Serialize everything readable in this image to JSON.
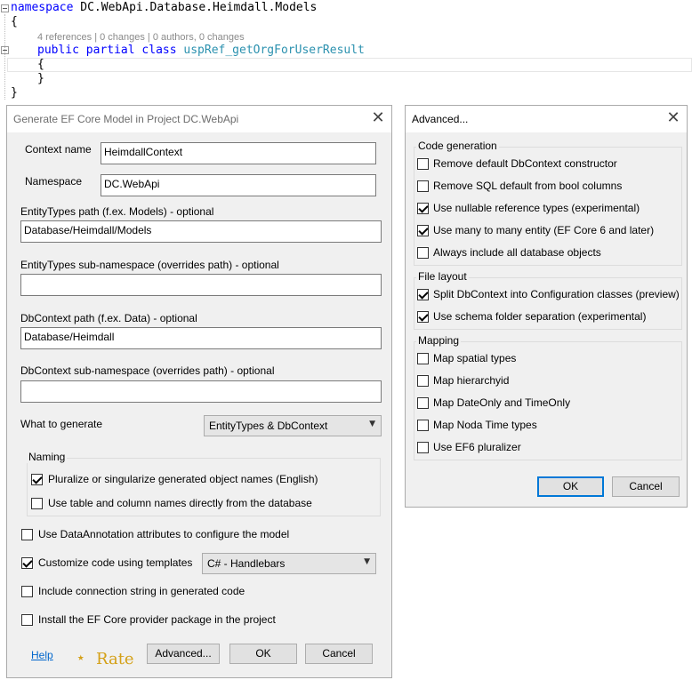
{
  "editor": {
    "line1_kw": "namespace",
    "line1_ns": " DC.WebApi.Database.Heimdall.Models",
    "open_brace": "{",
    "codelens": "4 references | 0 changes | 0 authors, 0 changes",
    "line3_kw1": "public",
    "line3_kw2": "partial",
    "line3_kw3": "class",
    "line3_class": "uspRef_getOrgForUserResult",
    "inner_open": "{",
    "inner_close": "}",
    "close_brace": "}"
  },
  "main_dialog": {
    "title": "Generate EF Core Model in Project DC.WebApi",
    "close": "✕",
    "context_name_label": "Context name",
    "context_name_value": "HeimdallContext",
    "namespace_label": "Namespace",
    "namespace_value": "DC.WebApi",
    "entity_path_label": "EntityTypes path (f.ex. Models) - optional",
    "entity_path_value": "Database/Heimdall/Models",
    "entity_subns_label": "EntityTypes sub-namespace (overrides path) - optional",
    "entity_subns_value": "",
    "dbcontext_path_label": "DbContext path (f.ex. Data) - optional",
    "dbcontext_path_value": "Database/Heimdall",
    "dbcontext_subns_label": "DbContext sub-namespace (overrides path) - optional",
    "dbcontext_subns_value": "",
    "what_to_generate_label": "What to generate",
    "what_to_generate_value": "EntityTypes & DbContext",
    "naming_caption": "Naming",
    "pluralize_label": "Pluralize or singularize generated object names (English)",
    "use_table_names_label": "Use table and column names directly from the database",
    "data_annotation_label": "Use DataAnnotation attributes to configure the model",
    "customize_templates_label": "Customize code using templates",
    "template_value": "C# - Handlebars",
    "include_conn_label": "Include connection string in generated code",
    "install_provider_label": "Install the EF Core provider package in the project",
    "help_link": "Help",
    "rate_star": "⭑",
    "rate_text": "Rate",
    "advanced_button": "Advanced...",
    "ok_button": "OK",
    "cancel_button": "Cancel"
  },
  "advanced_dialog": {
    "title": "Advanced...",
    "close": "✕",
    "code_generation_caption": "Code generation",
    "opt_remove_ctor": "Remove default DbContext constructor",
    "opt_remove_sql_default": "Remove SQL default from bool columns",
    "opt_nullable_refs": "Use nullable reference types (experimental)",
    "opt_many_to_many": "Use many to many entity (EF Core 6 and later)",
    "opt_include_all": "Always include all database objects",
    "file_layout_caption": "File layout",
    "opt_split_dbcontext": "Split DbContext into Configuration classes (preview)",
    "opt_schema_folders": "Use schema folder separation (experimental)",
    "mapping_caption": "Mapping",
    "opt_spatial": "Map spatial types",
    "opt_hierarchyid": "Map hierarchyid",
    "opt_dateonly": "Map DateOnly and TimeOnly",
    "opt_noda": "Map Noda Time types",
    "opt_ef6_pluralizer": "Use EF6 pluralizer",
    "ok_button": "OK",
    "cancel_button": "Cancel"
  },
  "checkbox_states": {
    "pluralize": true,
    "use_table_names": false,
    "data_annotation": false,
    "customize_templates": true,
    "include_conn": false,
    "install_provider": false,
    "remove_ctor": false,
    "remove_sql_default": false,
    "nullable_refs": true,
    "many_to_many": true,
    "include_all": false,
    "split_dbcontext": true,
    "schema_folders": true,
    "spatial": false,
    "hierarchyid": false,
    "dateonly": false,
    "noda": false,
    "ef6_pluralizer": false
  },
  "colors": {
    "keyword": "#0000ff",
    "class_name": "#2b91af",
    "accent": "#0078d7",
    "link": "#0066cc",
    "rate": "#d4a017"
  }
}
